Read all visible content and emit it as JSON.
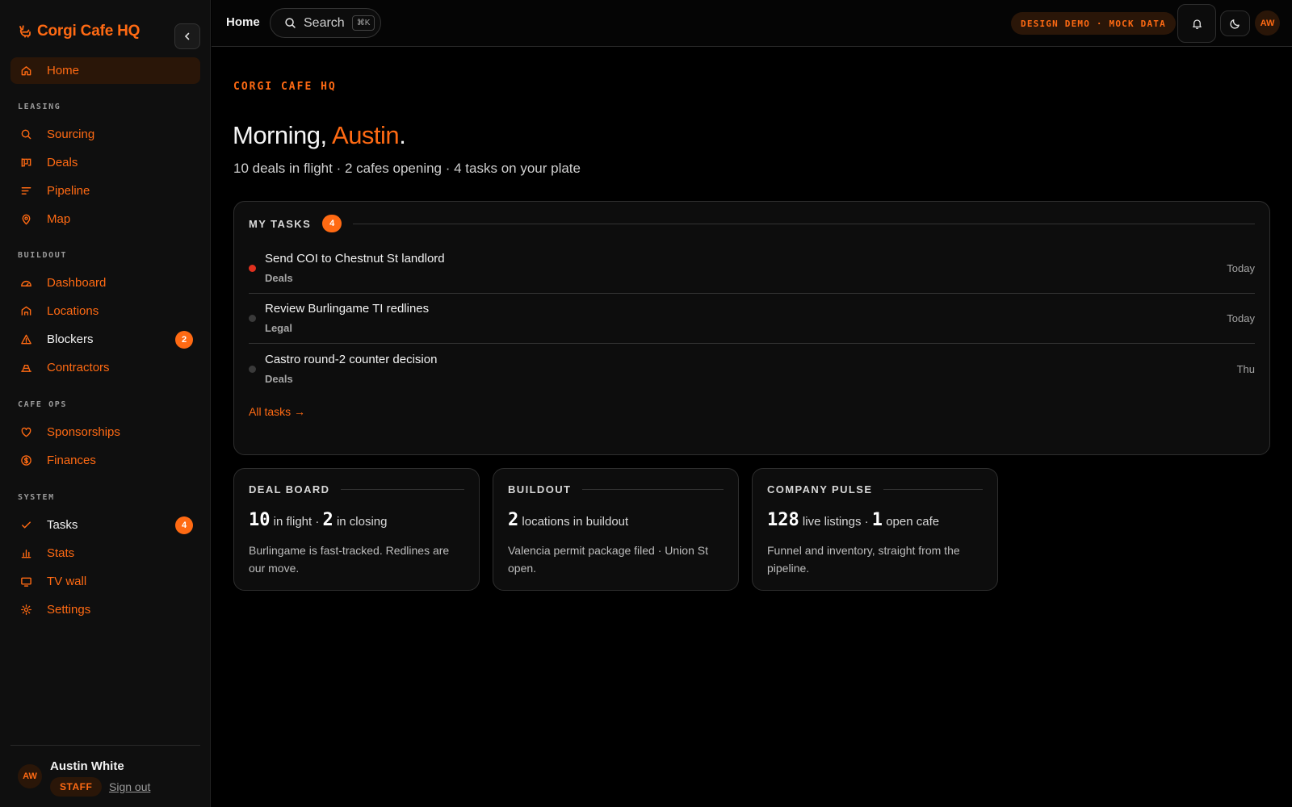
{
  "brand": {
    "name": "Corgi Cafe HQ",
    "accent": "#ff6a13"
  },
  "sidebar": {
    "home": {
      "label": "Home"
    },
    "sections": [
      {
        "label": "LEASING",
        "items": [
          {
            "label": "Sourcing",
            "icon": "search-icon"
          },
          {
            "label": "Deals",
            "icon": "kanban-icon"
          },
          {
            "label": "Pipeline",
            "icon": "pipeline-icon"
          },
          {
            "label": "Map",
            "icon": "map-pin-icon"
          }
        ]
      },
      {
        "label": "BUILDOUT",
        "items": [
          {
            "label": "Dashboard",
            "icon": "gauge-icon"
          },
          {
            "label": "Locations",
            "icon": "store-icon"
          },
          {
            "label": "Blockers",
            "icon": "warning-icon",
            "badge": "2"
          },
          {
            "label": "Contractors",
            "icon": "hard-hat-icon"
          }
        ]
      },
      {
        "label": "CAFE OPS",
        "items": [
          {
            "label": "Sponsorships",
            "icon": "heart-icon"
          },
          {
            "label": "Finances",
            "icon": "dollar-icon"
          }
        ]
      },
      {
        "label": "SYSTEM",
        "items": [
          {
            "label": "Tasks",
            "icon": "check-icon",
            "badge": "4"
          },
          {
            "label": "Stats",
            "icon": "bar-chart-icon"
          },
          {
            "label": "TV wall",
            "icon": "monitor-icon"
          },
          {
            "label": "Settings",
            "icon": "gear-icon"
          }
        ]
      }
    ],
    "user": {
      "initials": "AW",
      "name": "Austin White",
      "role": "STAFF",
      "signout": "Sign out"
    }
  },
  "topbar": {
    "crumb": "Home",
    "search_label": "Search",
    "search_shortcut": "⌘K",
    "demo_badge": "DESIGN DEMO · MOCK DATA",
    "avatar": "AW"
  },
  "main": {
    "eyebrow": "CORGI CAFE HQ",
    "greeting_prefix": "Morning, ",
    "greeting_name": "Austin",
    "greeting_suffix": ".",
    "summary": "10 deals in flight · 2 cafes opening · 4 tasks on your plate",
    "tasks": {
      "title": "MY TASKS",
      "count": "4",
      "items": [
        {
          "title": "Send COI to Chestnut St landlord",
          "tag": "Deals",
          "due": "Today",
          "urgent": true
        },
        {
          "title": "Review Burlingame TI redlines",
          "tag": "Legal",
          "due": "Today",
          "urgent": false
        },
        {
          "title": "Castro round-2 counter decision",
          "tag": "Deals",
          "due": "Thu",
          "urgent": false
        }
      ],
      "all_link": "All tasks →"
    },
    "cards": [
      {
        "title": "DEAL BOARD",
        "n1": "10",
        "t1": " in flight · ",
        "n2": "2",
        "t2": " in closing",
        "desc": "Burlingame is fast-tracked. Redlines are our move."
      },
      {
        "title": "BUILDOUT",
        "n1": "2",
        "t1": " locations in buildout",
        "n2": "",
        "t2": "",
        "desc": "Valencia permit package filed · Union St open."
      },
      {
        "title": "COMPANY PULSE",
        "n1": "128",
        "t1": " live listings · ",
        "n2": "1",
        "t2": " open cafe",
        "desc": "Funnel and inventory, straight from the pipeline."
      }
    ]
  }
}
